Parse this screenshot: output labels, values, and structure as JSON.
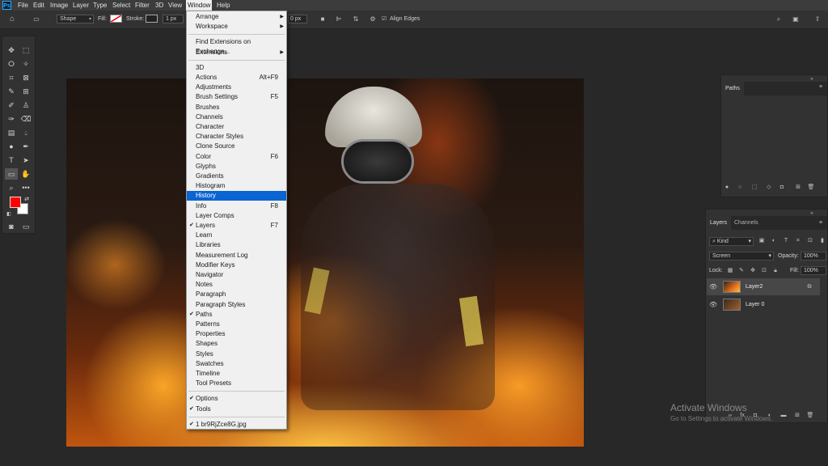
{
  "app": {
    "logo": "Ps"
  },
  "menubar": [
    "File",
    "Edit",
    "Image",
    "Layer",
    "Type",
    "Select",
    "Filter",
    "3D",
    "View",
    "Window",
    "Help"
  ],
  "options": {
    "mode": "Shape",
    "fill_label": "Fill:",
    "stroke_label": "Stroke:",
    "stroke_width": "1 px",
    "dims": "0 px",
    "align_edges": "Align Edges"
  },
  "window_menu": {
    "items": [
      {
        "label": "Arrange",
        "submenu": true
      },
      {
        "label": "Workspace",
        "submenu": true
      },
      {
        "sep": true
      },
      {
        "label": "Find Extensions on Exchange..."
      },
      {
        "label": "Extensions",
        "submenu": true
      },
      {
        "sep": true
      },
      {
        "label": "3D"
      },
      {
        "label": "Actions",
        "shortcut": "Alt+F9"
      },
      {
        "label": "Adjustments"
      },
      {
        "label": "Brush Settings",
        "shortcut": "F5"
      },
      {
        "label": "Brushes"
      },
      {
        "label": "Channels"
      },
      {
        "label": "Character"
      },
      {
        "label": "Character Styles"
      },
      {
        "label": "Clone Source"
      },
      {
        "label": "Color",
        "shortcut": "F6"
      },
      {
        "label": "Glyphs"
      },
      {
        "label": "Gradients"
      },
      {
        "label": "Histogram"
      },
      {
        "label": "History",
        "highlight": true
      },
      {
        "label": "Info",
        "shortcut": "F8"
      },
      {
        "label": "Layer Comps"
      },
      {
        "label": "Layers",
        "shortcut": "F7",
        "checked": true
      },
      {
        "label": "Learn"
      },
      {
        "label": "Libraries"
      },
      {
        "label": "Measurement Log"
      },
      {
        "label": "Modifier Keys"
      },
      {
        "label": "Navigator"
      },
      {
        "label": "Notes"
      },
      {
        "label": "Paragraph"
      },
      {
        "label": "Paragraph Styles"
      },
      {
        "label": "Paths",
        "checked": true
      },
      {
        "label": "Patterns"
      },
      {
        "label": "Properties"
      },
      {
        "label": "Shapes"
      },
      {
        "label": "Styles"
      },
      {
        "label": "Swatches"
      },
      {
        "label": "Timeline"
      },
      {
        "label": "Tool Presets"
      },
      {
        "sep": true
      },
      {
        "label": "Options",
        "checked": true
      },
      {
        "label": "Tools",
        "checked": true
      },
      {
        "sep": true
      },
      {
        "label": "1 br9RjZce8G.jpg",
        "checked": true
      }
    ]
  },
  "paths_panel": {
    "tab": "Paths"
  },
  "layers_panel": {
    "tabs": [
      "Layers",
      "Channels"
    ],
    "filter": "Kind",
    "blend_mode": "Screen",
    "opacity_label": "Opacity:",
    "opacity": "100%",
    "lock_label": "Lock:",
    "fill_label": "Fill:",
    "fill": "100%",
    "layers": [
      {
        "name": "Layer2",
        "selected": true
      },
      {
        "name": "Layer 0",
        "selected": false
      }
    ]
  },
  "watermark": {
    "title": "Activate Windows",
    "subtitle": "Go to Settings to activate Windows."
  },
  "colors": {
    "foreground": "#ff0000",
    "background": "#ffffff",
    "highlight": "#0a64d2"
  }
}
